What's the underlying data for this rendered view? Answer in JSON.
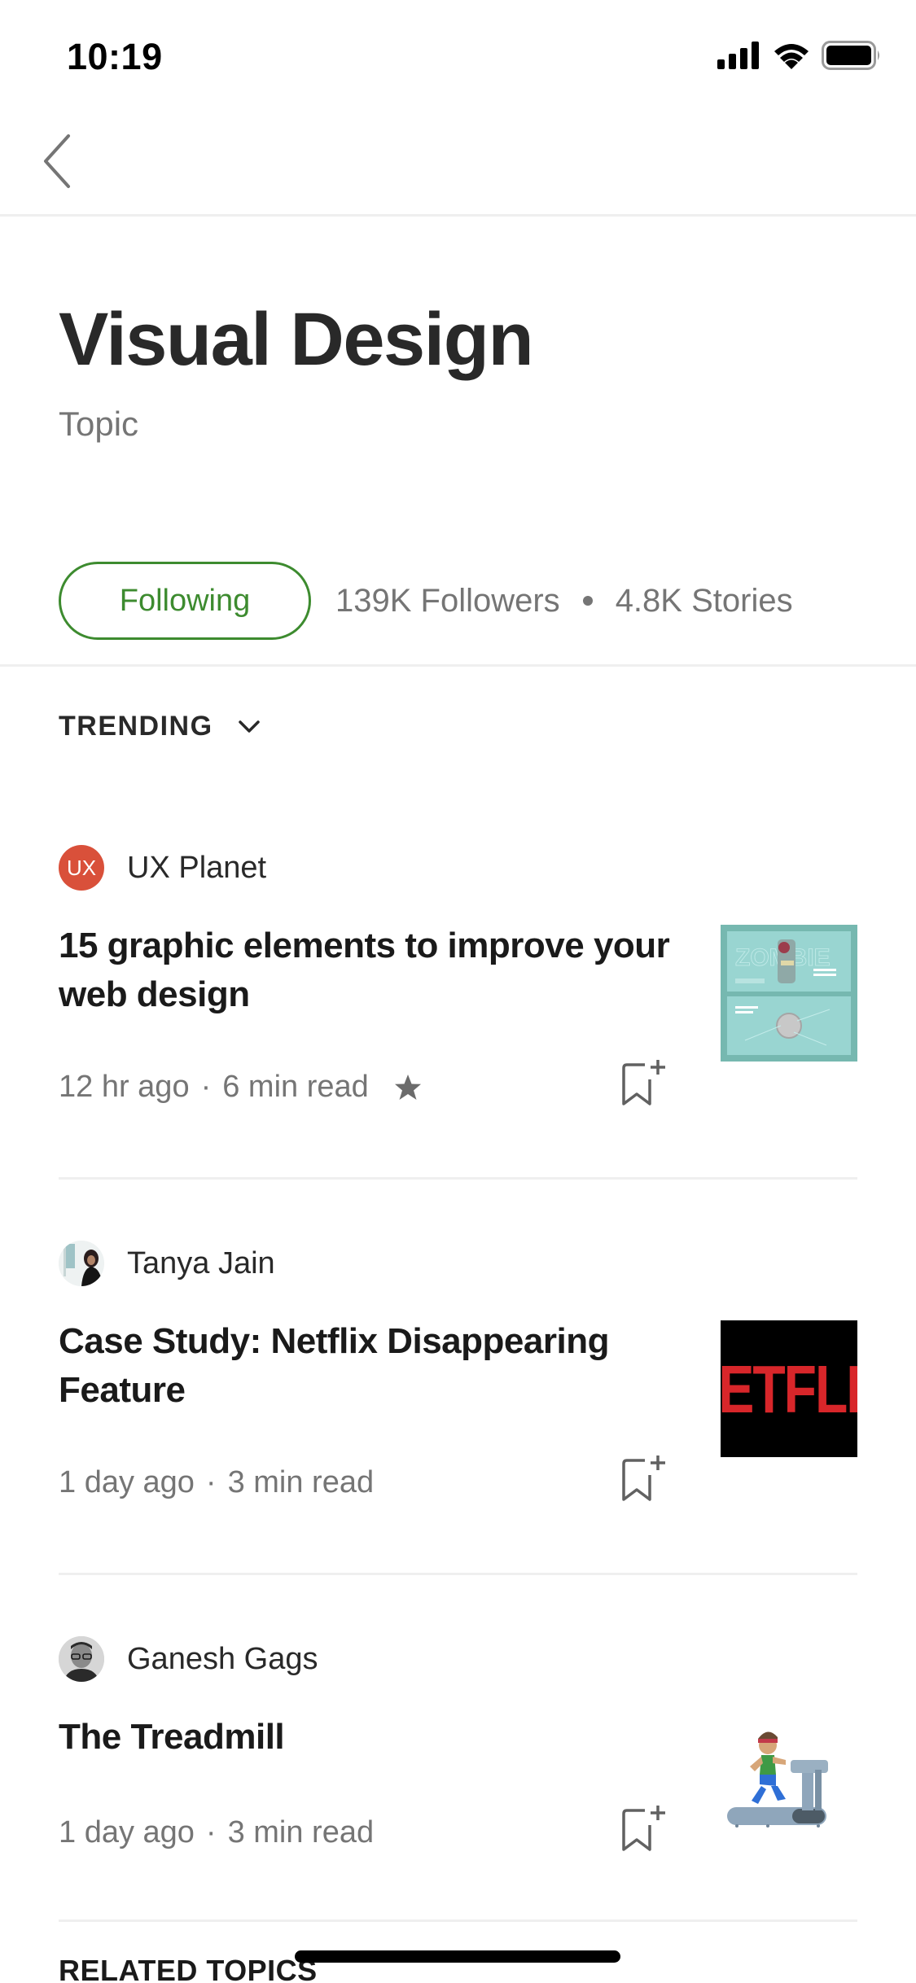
{
  "status_bar": {
    "time": "10:19",
    "icons": [
      "signal-icon",
      "wifi-icon",
      "battery-icon"
    ]
  },
  "nav": {
    "back_icon": "chevron-left-icon"
  },
  "topic": {
    "title": "Visual Design",
    "subtitle": "Topic",
    "follow_button_label": "Following",
    "followers": "139K Followers",
    "stories": "4.8K Stories"
  },
  "sort": {
    "label": "TRENDING",
    "icon": "chevron-down-icon"
  },
  "articles": [
    {
      "publication": "UX Planet",
      "avatar_text": "UX",
      "title": "15 graphic elements to improve your web design",
      "time_ago": "12 hr ago",
      "separator": "·",
      "read_time": "6 min read",
      "member_only": true,
      "thumbnail": "zombie-can-design"
    },
    {
      "publication": "Tanya Jain",
      "avatar_text": "",
      "title": "Case Study: Netflix Disappearing Feature",
      "time_ago": "1 day ago",
      "separator": "·",
      "read_time": "3 min read",
      "member_only": false,
      "thumbnail": "netflix-logo",
      "thumbnail_text": "ETFLI"
    },
    {
      "publication": "Ganesh Gags",
      "avatar_text": "",
      "title": "The Treadmill",
      "time_ago": "1 day ago",
      "separator": "·",
      "read_time": "3 min read",
      "member_only": false,
      "thumbnail": "treadmill-runner"
    }
  ],
  "related_topics": {
    "label": "RELATED TOPICS"
  },
  "colors": {
    "accent_green": "#3d8b2f",
    "text_dark": "#292929",
    "text_gray": "#757575",
    "ux_planet_red": "#d9503a",
    "netflix_red": "#d8262a",
    "thumb_teal": "#7cbcb5"
  }
}
